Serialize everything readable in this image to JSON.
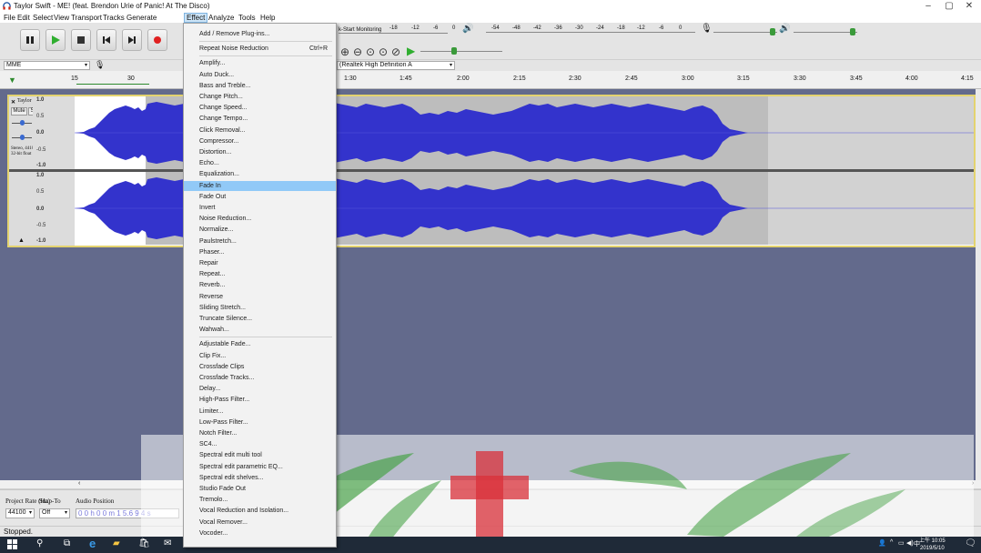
{
  "window": {
    "title": "Taylor Swift - ME! (feat. Brendon Urie of Panic! At The Disco)",
    "minimize": "–",
    "maximize": "▢",
    "close": "✕"
  },
  "menubar": [
    "File",
    "Edit",
    "Select",
    "View",
    "Transport",
    "Tracks",
    "Generate",
    "Effect",
    "Analyze",
    "Tools",
    "Help"
  ],
  "meter": {
    "monitor_label": "k-Start Monitoring",
    "ticks_top": [
      "-18",
      "-12",
      "-6",
      "0"
    ],
    "ticks_right": [
      "-54",
      "-48",
      "-42",
      "-36",
      "-30",
      "-24",
      "-18",
      "-12",
      "-6",
      "0"
    ]
  },
  "device": {
    "host": "MME",
    "output": "(Realtek High Definition A"
  },
  "ruler": {
    "left_ticks": [
      "15",
      "30"
    ],
    "ticks": [
      "1:30",
      "1:45",
      "2:00",
      "2:15",
      "2:30",
      "2:45",
      "3:00",
      "3:15",
      "3:30",
      "3:45",
      "4:00",
      "4:15"
    ]
  },
  "track": {
    "name": "Taylor Swift",
    "mute": "Mute",
    "solo": "Solo",
    "info": "Stereo, 44100Hz\n32-bit float",
    "scale": [
      "1.0",
      "0.5",
      "0.0",
      "-0.5",
      "-1.0"
    ]
  },
  "selection": {
    "project_rate_label": "Project Rate (Hz)",
    "snap_label": "Snap-To",
    "audio_position_label": "Audio Position",
    "project_rate": "44100",
    "snap": "Off",
    "audio_position": "0 0 h 0 0 m 1 5.6 9 4 s"
  },
  "status": "Stopped.",
  "effect_menu": {
    "items": [
      {
        "label": "Add / Remove Plug-ins...",
        "shortcut": ""
      },
      {
        "label": "Repeat Noise Reduction",
        "shortcut": "Ctrl+R"
      },
      {
        "label": "Amplify...",
        "shortcut": ""
      },
      {
        "label": "Auto Duck...",
        "shortcut": ""
      },
      {
        "label": "Bass and Treble...",
        "shortcut": ""
      },
      {
        "label": "Change Pitch...",
        "shortcut": ""
      },
      {
        "label": "Change Speed...",
        "shortcut": ""
      },
      {
        "label": "Change Tempo...",
        "shortcut": ""
      },
      {
        "label": "Click Removal...",
        "shortcut": ""
      },
      {
        "label": "Compressor...",
        "shortcut": ""
      },
      {
        "label": "Distortion...",
        "shortcut": ""
      },
      {
        "label": "Echo...",
        "shortcut": ""
      },
      {
        "label": "Equalization...",
        "shortcut": ""
      },
      {
        "label": "Fade In",
        "shortcut": ""
      },
      {
        "label": "Fade Out",
        "shortcut": ""
      },
      {
        "label": "Invert",
        "shortcut": ""
      },
      {
        "label": "Noise Reduction...",
        "shortcut": ""
      },
      {
        "label": "Normalize...",
        "shortcut": ""
      },
      {
        "label": "Paulstretch...",
        "shortcut": ""
      },
      {
        "label": "Phaser...",
        "shortcut": ""
      },
      {
        "label": "Repair",
        "shortcut": ""
      },
      {
        "label": "Repeat...",
        "shortcut": ""
      },
      {
        "label": "Reverb...",
        "shortcut": ""
      },
      {
        "label": "Reverse",
        "shortcut": ""
      },
      {
        "label": "Sliding Stretch...",
        "shortcut": ""
      },
      {
        "label": "Truncate Silence...",
        "shortcut": ""
      },
      {
        "label": "Wahwah...",
        "shortcut": ""
      },
      {
        "label": "Adjustable Fade...",
        "shortcut": ""
      },
      {
        "label": "Clip Fix...",
        "shortcut": ""
      },
      {
        "label": "Crossfade Clips",
        "shortcut": ""
      },
      {
        "label": "Crossfade Tracks...",
        "shortcut": ""
      },
      {
        "label": "Delay...",
        "shortcut": ""
      },
      {
        "label": "High-Pass Filter...",
        "shortcut": ""
      },
      {
        "label": "Limiter...",
        "shortcut": ""
      },
      {
        "label": "Low-Pass Filter...",
        "shortcut": ""
      },
      {
        "label": "Notch Filter...",
        "shortcut": ""
      },
      {
        "label": "SC4...",
        "shortcut": ""
      },
      {
        "label": "Spectral edit multi tool",
        "shortcut": ""
      },
      {
        "label": "Spectral edit parametric EQ...",
        "shortcut": ""
      },
      {
        "label": "Spectral edit shelves...",
        "shortcut": ""
      },
      {
        "label": "Studio Fade Out",
        "shortcut": ""
      },
      {
        "label": "Tremolo...",
        "shortcut": ""
      },
      {
        "label": "Vocal Reduction and Isolation...",
        "shortcut": ""
      },
      {
        "label": "Vocal Remover...",
        "shortcut": ""
      },
      {
        "label": "Vocoder...",
        "shortcut": ""
      }
    ],
    "highlighted": "Fade In"
  },
  "taskbar": {
    "time": "上午 10:05",
    "date": "2019/5/10",
    "ime": "中"
  },
  "colors": {
    "waveform": "#3333cc",
    "track_bg": "#636a8c",
    "selection": "#bdbdbd",
    "highlight": "#91c9f7"
  }
}
